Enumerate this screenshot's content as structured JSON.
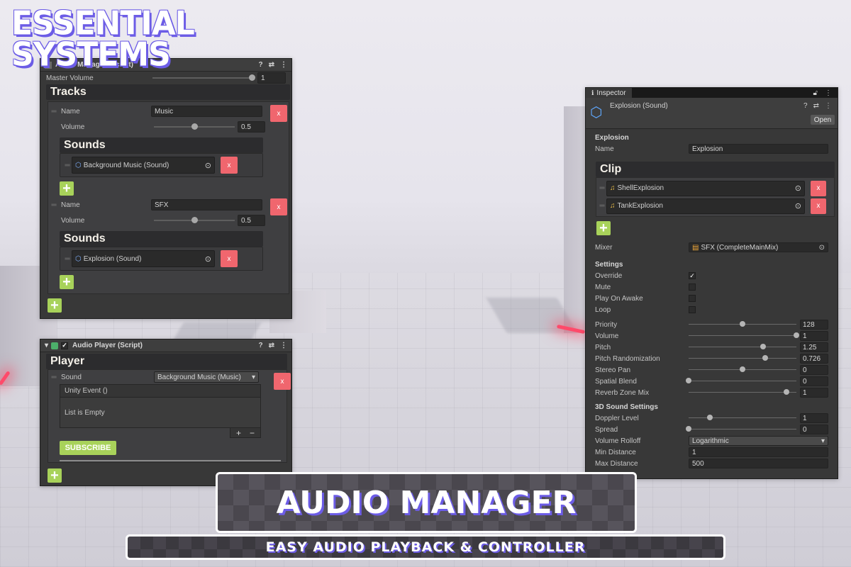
{
  "brand": {
    "line1": "ESSENTIAL",
    "line2": "SYSTEMS"
  },
  "audio_manager": {
    "header_title": "Audio Manager (Script)",
    "master_volume_label": "Master Volume",
    "master_volume_value": "1",
    "master_volume_fraction": 1.0,
    "tracks_title": "Tracks",
    "tracks": [
      {
        "name_label": "Name",
        "name_value": "Music",
        "volume_label": "Volume",
        "volume_value": "0.5",
        "volume_fraction": 0.5,
        "sounds_title": "Sounds",
        "sound_item": "Background Music (Sound)",
        "remove_label": "x"
      },
      {
        "name_label": "Name",
        "name_value": "SFX",
        "volume_label": "Volume",
        "volume_value": "0.5",
        "volume_fraction": 0.5,
        "sounds_title": "Sounds",
        "sound_item": "Explosion (Sound)",
        "remove_label": "x"
      }
    ],
    "add_label": "+"
  },
  "player": {
    "header_title": "Audio Player (Script)",
    "section_title": "Player",
    "sound_label": "Sound",
    "sound_value": "Background Music (Music)",
    "remove_label": "x",
    "event_title": "Unity Event ()",
    "event_empty": "List is Empty",
    "event_add": "+",
    "event_remove": "−",
    "subscribe_label": "SUBSCRIBE",
    "add_label": "+"
  },
  "inspector": {
    "tab_title": "Inspector",
    "asset_title": "Explosion (Sound)",
    "open_label": "Open",
    "section_title": "Explosion",
    "name_label": "Name",
    "name_value": "Explosion",
    "clip_title": "Clip",
    "clips": [
      "ShellExplosion",
      "TankExplosion"
    ],
    "clip_remove_label": "x",
    "mixer_label": "Mixer",
    "mixer_value": "SFX (CompleteMainMix)",
    "settings_title": "Settings",
    "toggles": [
      {
        "label": "Override",
        "checked": true
      },
      {
        "label": "Mute",
        "checked": false
      },
      {
        "label": "Play On Awake",
        "checked": false
      },
      {
        "label": "Loop",
        "checked": false
      }
    ],
    "sliders": [
      {
        "label": "Priority",
        "value": "128",
        "fraction": 0.5
      },
      {
        "label": "Volume",
        "value": "1",
        "fraction": 1.0
      },
      {
        "label": "Pitch",
        "value": "1.25",
        "fraction": 0.69
      },
      {
        "label": "Pitch Randomization",
        "value": "0.726",
        "fraction": 0.71
      },
      {
        "label": "Stereo Pan",
        "value": "0",
        "fraction": 0.5
      },
      {
        "label": "Spatial Blend",
        "value": "0",
        "fraction": 0.0
      },
      {
        "label": "Reverb Zone Mix",
        "value": "1",
        "fraction": 0.91
      }
    ],
    "sound3d_title": "3D Sound Settings",
    "sliders3d": [
      {
        "label": "Doppler Level",
        "value": "1",
        "fraction": 0.2
      },
      {
        "label": "Spread",
        "value": "0",
        "fraction": 0.0
      }
    ],
    "rolloff_label": "Volume Rolloff",
    "rolloff_value": "Logarithmic",
    "min_distance_label": "Min Distance",
    "min_distance_value": "1",
    "max_distance_label": "Max Distance",
    "max_distance_value": "500"
  },
  "title": "AUDIO MANAGER",
  "subtitle": "EASY AUDIO PLAYBACK & CONTROLLER",
  "colors": {
    "remove": "#f0666e",
    "add": "#a8d25a",
    "panel": "#383838",
    "accent_shadow": "#6c5ce6"
  }
}
